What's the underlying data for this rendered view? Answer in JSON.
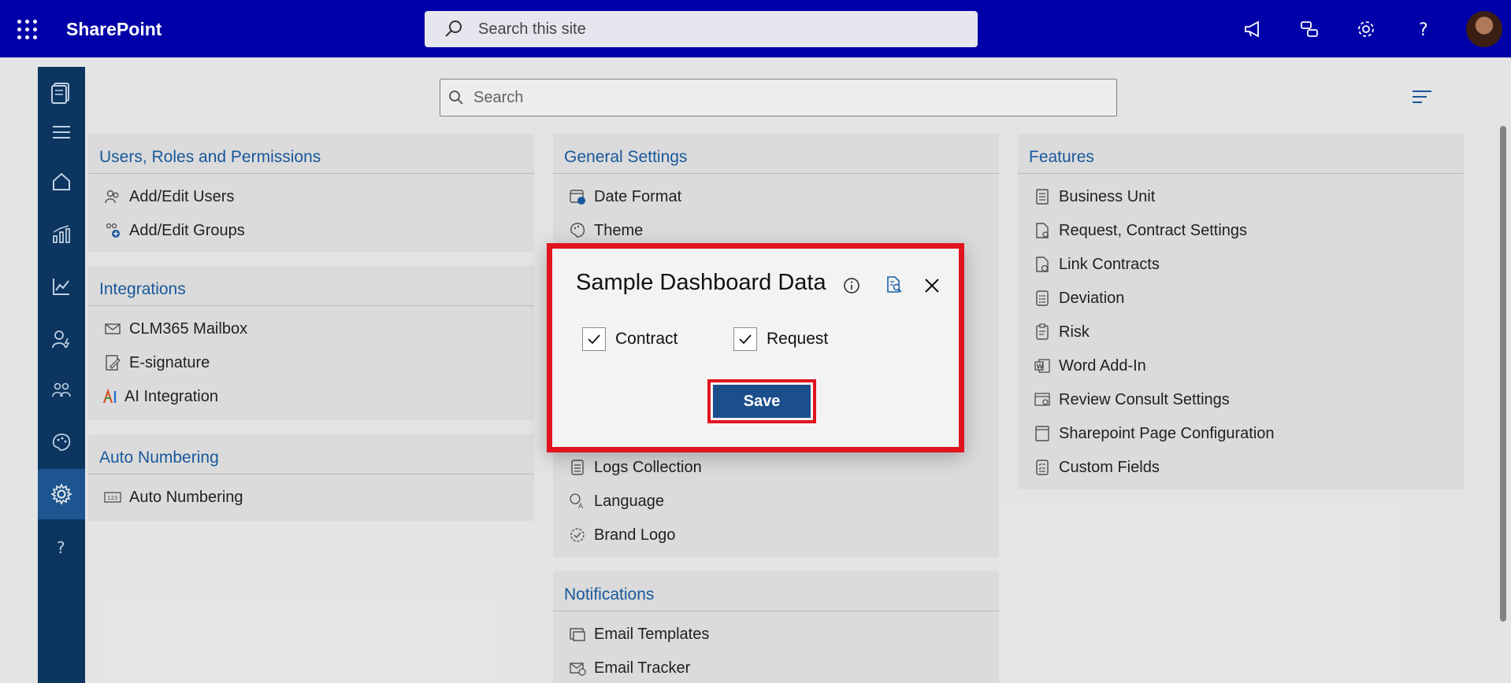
{
  "header": {
    "brand": "SharePoint",
    "site_search_placeholder": "Search this site"
  },
  "main": {
    "search_placeholder": "Search"
  },
  "sections": {
    "users": {
      "title": "Users, Roles and Permissions",
      "items": [
        "Add/Edit Users",
        "Add/Edit Groups"
      ]
    },
    "integrations": {
      "title": "Integrations",
      "items": [
        "CLM365 Mailbox",
        "E-signature",
        "AI Integration"
      ]
    },
    "auto_numbering": {
      "title": "Auto Numbering",
      "items": [
        "Auto Numbering"
      ]
    },
    "general": {
      "title": "General Settings",
      "items": [
        "Date Format",
        "Theme",
        "Logs Collection",
        "Language",
        "Brand Logo"
      ]
    },
    "notifications": {
      "title": "Notifications",
      "items": [
        "Email Templates",
        "Email Tracker"
      ]
    },
    "features": {
      "title": "Features",
      "items": [
        "Business Unit",
        "Request, Contract Settings",
        "Link Contracts",
        "Deviation",
        "Risk",
        "Word Add-In",
        "Review Consult Settings",
        "Sharepoint Page Configuration",
        "Custom Fields"
      ]
    }
  },
  "dialog": {
    "title": "Sample Dashboard Data",
    "checkbox_contract": "Contract",
    "checkbox_request": "Request",
    "save_label": "Save"
  },
  "colors": {
    "topbar": "#0000a8",
    "rail": "#0d3a68",
    "section_title": "#1a5fa8",
    "highlight": "#e0141e",
    "save_button": "#1b4f8c"
  }
}
